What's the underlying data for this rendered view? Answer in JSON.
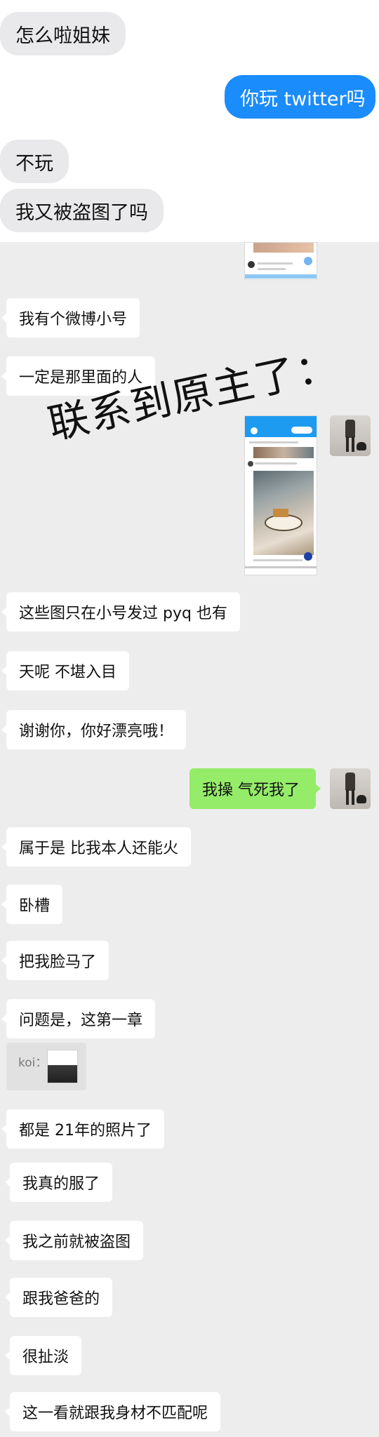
{
  "top_messages": [
    {
      "side": "left",
      "text": "怎么啦姐妹"
    },
    {
      "side": "right",
      "text": "你玩 twitter吗"
    },
    {
      "side": "left",
      "text": "不玩"
    },
    {
      "side": "left",
      "text": "我又被盗图了吗"
    }
  ],
  "chat_messages": {
    "m1": "我有个微博小号",
    "m2": "一定是那里面的人",
    "m3": "这些图只在小号发过 pyq 也有",
    "m4": "天呢 不堪入目",
    "m5": "谢谢你，你好漂亮哦！",
    "m6": "我操 气死我了",
    "m7": "属于是 比我本人还能火",
    "m8": "卧槽",
    "m9": "把我脸马了",
    "m10": "问题是，这第一章",
    "m11": "都是 21年的照片了",
    "m12": "我真的服了",
    "m13": "我之前就被盗图",
    "m14": "跟我爸爸的",
    "m15": "很扯淡",
    "m16": "这一看就跟我身材不匹配呢"
  },
  "overlay_text": "联系到原主了：",
  "quote": {
    "label": "koi："
  },
  "colors": {
    "imessage_blue": "#1a8cfb",
    "imessage_gray": "#e9e9eb",
    "wechat_green": "#95ec69",
    "wechat_bg": "#ededed"
  }
}
